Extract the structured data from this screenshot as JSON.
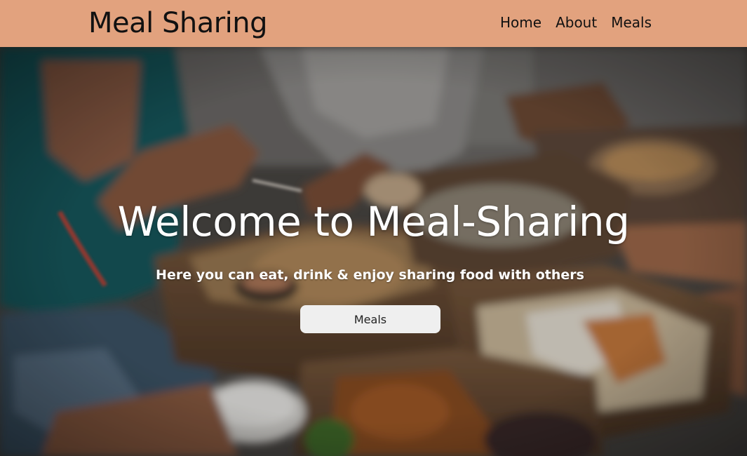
{
  "navbar": {
    "brand": "Meal Sharing",
    "links": [
      {
        "label": "Home"
      },
      {
        "label": "About"
      },
      {
        "label": "Meals"
      }
    ],
    "background_color": "#e2a27e"
  },
  "hero": {
    "title": "Welcome to Meal-Sharing",
    "subtitle": "Here you can eat, drink & enjoy sharing food with others",
    "button_label": "Meals",
    "background_image": "people-sharing-takeaway-food-photo"
  }
}
